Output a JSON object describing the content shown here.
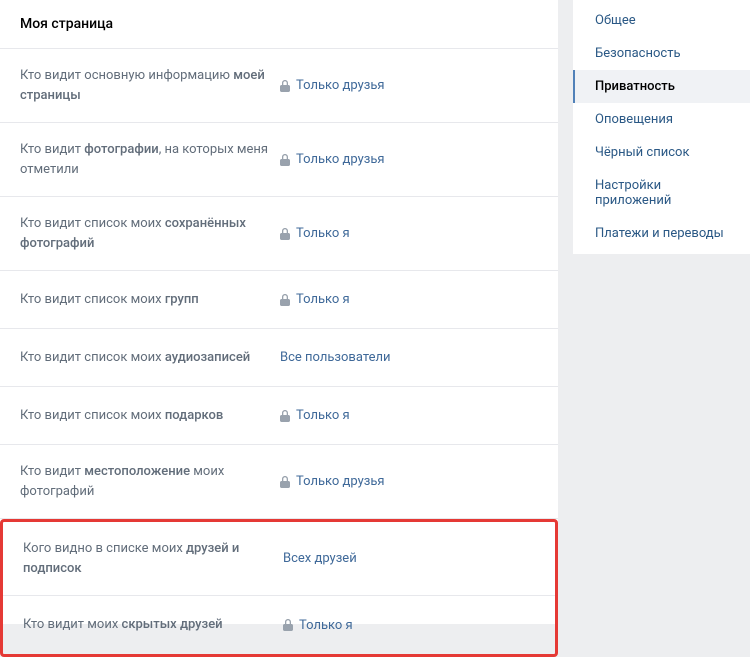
{
  "header": {
    "title": "Моя страница"
  },
  "settings": [
    {
      "label_start": "Кто видит основную информацию ",
      "label_bold": "моей страницы",
      "label_end": "",
      "has_lock": true,
      "value": "Только друзья"
    },
    {
      "label_start": "Кто видит ",
      "label_bold": "фотографии",
      "label_end": ", на которых меня отметили",
      "has_lock": true,
      "value": "Только друзья"
    },
    {
      "label_start": "Кто видит список моих ",
      "label_bold": "сохранённых фотографий",
      "label_end": "",
      "has_lock": true,
      "value": "Только я"
    },
    {
      "label_start": "Кто видит список моих ",
      "label_bold": "групп",
      "label_end": "",
      "has_lock": true,
      "value": "Только я"
    },
    {
      "label_start": "Кто видит список моих ",
      "label_bold": "аудиозаписей",
      "label_end": "",
      "has_lock": false,
      "value": "Все пользователи"
    },
    {
      "label_start": "Кто видит список моих ",
      "label_bold": "подарков",
      "label_end": "",
      "has_lock": true,
      "value": "Только я"
    },
    {
      "label_start": "Кто видит ",
      "label_bold": "местоположение",
      "label_end": " моих фотографий",
      "has_lock": true,
      "value": "Только друзья"
    }
  ],
  "highlighted_settings": [
    {
      "label_start": "Кого видно в списке моих ",
      "label_bold": "друзей и подписок",
      "label_end": "",
      "has_lock": false,
      "value": "Всех друзей"
    },
    {
      "label_start": "Кто видит моих ",
      "label_bold": "скрытых друзей",
      "label_end": "",
      "has_lock": true,
      "value": "Только я"
    }
  ],
  "sidebar": {
    "items": [
      {
        "label": "Общее",
        "active": false
      },
      {
        "label": "Безопасность",
        "active": false
      },
      {
        "label": "Приватность",
        "active": true
      },
      {
        "label": "Оповещения",
        "active": false
      },
      {
        "label": "Чёрный список",
        "active": false
      },
      {
        "label": "Настройки приложений",
        "active": false
      },
      {
        "label": "Платежи и переводы",
        "active": false
      }
    ]
  }
}
